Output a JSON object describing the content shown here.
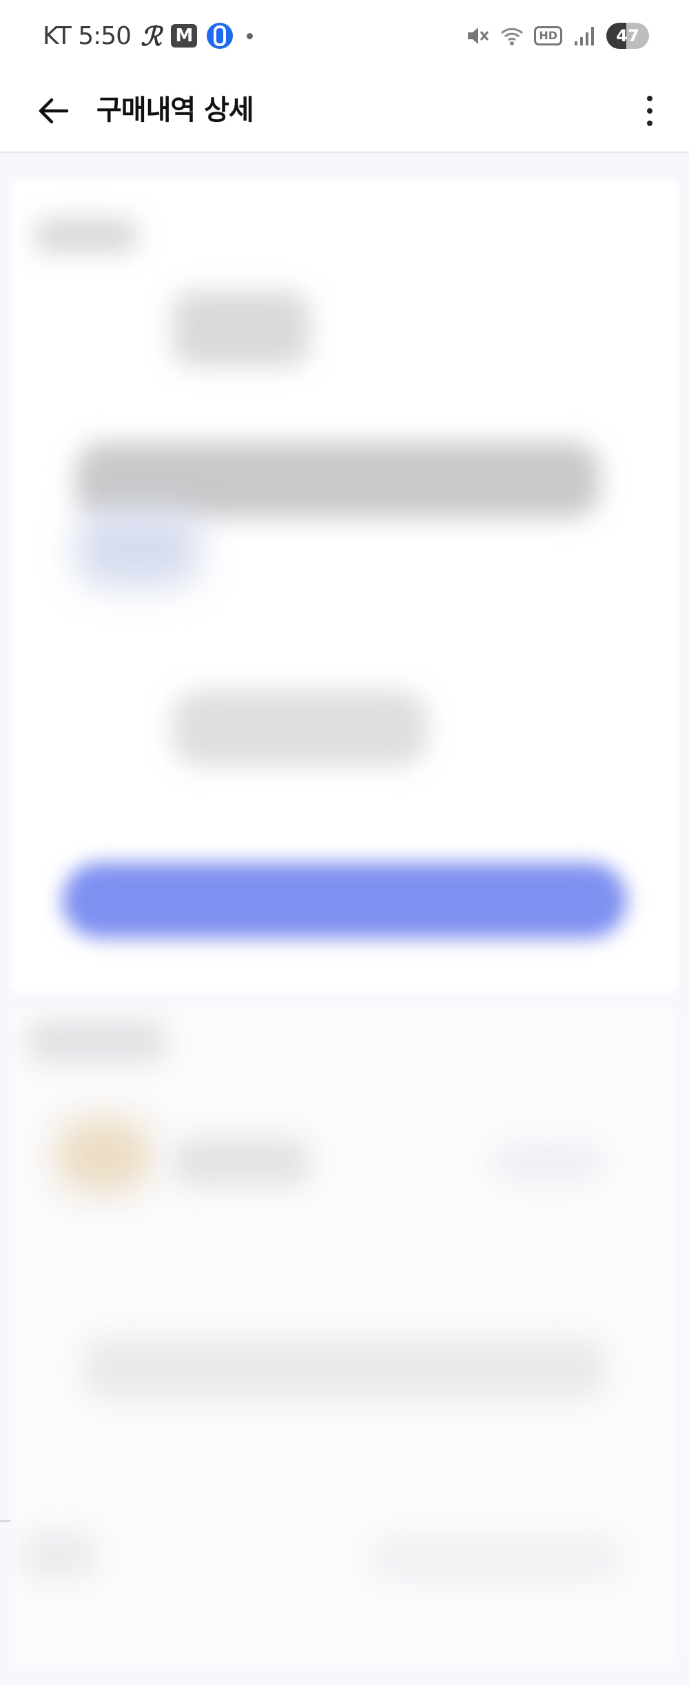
{
  "status_bar": {
    "carrier_time": "KT 5:50",
    "app_r": "ℛ",
    "app_m": "M",
    "battery_level": "47"
  },
  "app_bar": {
    "title": "구매내역 상세"
  },
  "colors": {
    "primary_button": "#7f90f1",
    "background": "#f7f8fc"
  },
  "icons": {
    "back": "arrow-left-icon",
    "more": "more-vertical-icon",
    "mute": "mute-icon",
    "wifi": "wifi-icon",
    "hd": "hd-voice-icon",
    "signal": "signal-icon",
    "battery": "battery-icon"
  }
}
